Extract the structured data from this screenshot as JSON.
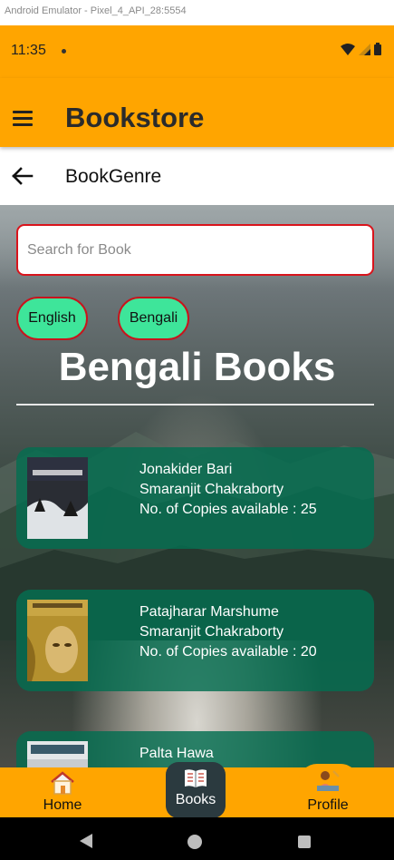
{
  "emulator_title": "Android Emulator - Pixel_4_API_28:5554",
  "status_bar": {
    "time": "11:35"
  },
  "app_bar": {
    "title": "Bookstore"
  },
  "sub_bar": {
    "title": "BookGenre"
  },
  "search": {
    "placeholder": "Search for Book",
    "value": ""
  },
  "genres": [
    {
      "label": "English"
    },
    {
      "label": "Bengali"
    }
  ],
  "section_title": "Bengali Books",
  "books": [
    {
      "title": "Jonakider Bari",
      "author": "Smaranjit Chakraborty",
      "copies": "No. of Copies available : 25"
    },
    {
      "title": "Patajharar Marshume",
      "author": "Smaranjit Chakraborty",
      "copies": "No. of Copies available : 20"
    },
    {
      "title": "Palta Hawa",
      "author": "",
      "copies": ""
    }
  ],
  "bottom_nav": {
    "home": "Home",
    "books": "Books",
    "profile": "Profile"
  },
  "colors": {
    "accent": "#FFA500",
    "chip": "#3ee59a",
    "chip_border": "#c8141c",
    "card": "#046e50"
  }
}
